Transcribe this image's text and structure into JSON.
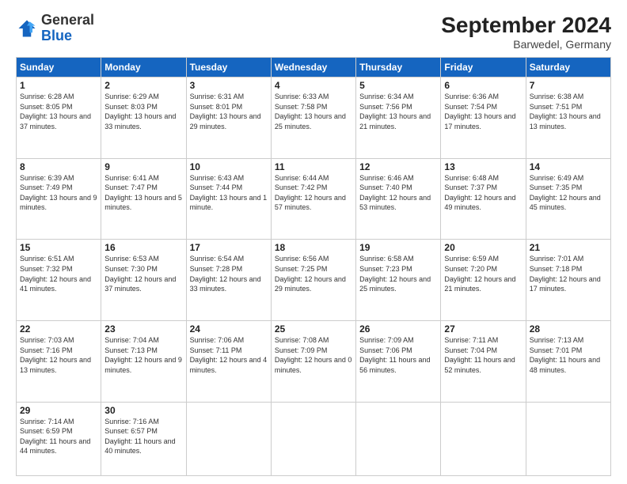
{
  "logo": {
    "general": "General",
    "blue": "Blue"
  },
  "title": "September 2024",
  "location": "Barwedel, Germany",
  "days_header": [
    "Sunday",
    "Monday",
    "Tuesday",
    "Wednesday",
    "Thursday",
    "Friday",
    "Saturday"
  ],
  "weeks": [
    [
      {
        "day": "1",
        "sunrise": "Sunrise: 6:28 AM",
        "sunset": "Sunset: 8:05 PM",
        "daylight": "Daylight: 13 hours and 37 minutes."
      },
      {
        "day": "2",
        "sunrise": "Sunrise: 6:29 AM",
        "sunset": "Sunset: 8:03 PM",
        "daylight": "Daylight: 13 hours and 33 minutes."
      },
      {
        "day": "3",
        "sunrise": "Sunrise: 6:31 AM",
        "sunset": "Sunset: 8:01 PM",
        "daylight": "Daylight: 13 hours and 29 minutes."
      },
      {
        "day": "4",
        "sunrise": "Sunrise: 6:33 AM",
        "sunset": "Sunset: 7:58 PM",
        "daylight": "Daylight: 13 hours and 25 minutes."
      },
      {
        "day": "5",
        "sunrise": "Sunrise: 6:34 AM",
        "sunset": "Sunset: 7:56 PM",
        "daylight": "Daylight: 13 hours and 21 minutes."
      },
      {
        "day": "6",
        "sunrise": "Sunrise: 6:36 AM",
        "sunset": "Sunset: 7:54 PM",
        "daylight": "Daylight: 13 hours and 17 minutes."
      },
      {
        "day": "7",
        "sunrise": "Sunrise: 6:38 AM",
        "sunset": "Sunset: 7:51 PM",
        "daylight": "Daylight: 13 hours and 13 minutes."
      }
    ],
    [
      {
        "day": "8",
        "sunrise": "Sunrise: 6:39 AM",
        "sunset": "Sunset: 7:49 PM",
        "daylight": "Daylight: 13 hours and 9 minutes."
      },
      {
        "day": "9",
        "sunrise": "Sunrise: 6:41 AM",
        "sunset": "Sunset: 7:47 PM",
        "daylight": "Daylight: 13 hours and 5 minutes."
      },
      {
        "day": "10",
        "sunrise": "Sunrise: 6:43 AM",
        "sunset": "Sunset: 7:44 PM",
        "daylight": "Daylight: 13 hours and 1 minute."
      },
      {
        "day": "11",
        "sunrise": "Sunrise: 6:44 AM",
        "sunset": "Sunset: 7:42 PM",
        "daylight": "Daylight: 12 hours and 57 minutes."
      },
      {
        "day": "12",
        "sunrise": "Sunrise: 6:46 AM",
        "sunset": "Sunset: 7:40 PM",
        "daylight": "Daylight: 12 hours and 53 minutes."
      },
      {
        "day": "13",
        "sunrise": "Sunrise: 6:48 AM",
        "sunset": "Sunset: 7:37 PM",
        "daylight": "Daylight: 12 hours and 49 minutes."
      },
      {
        "day": "14",
        "sunrise": "Sunrise: 6:49 AM",
        "sunset": "Sunset: 7:35 PM",
        "daylight": "Daylight: 12 hours and 45 minutes."
      }
    ],
    [
      {
        "day": "15",
        "sunrise": "Sunrise: 6:51 AM",
        "sunset": "Sunset: 7:32 PM",
        "daylight": "Daylight: 12 hours and 41 minutes."
      },
      {
        "day": "16",
        "sunrise": "Sunrise: 6:53 AM",
        "sunset": "Sunset: 7:30 PM",
        "daylight": "Daylight: 12 hours and 37 minutes."
      },
      {
        "day": "17",
        "sunrise": "Sunrise: 6:54 AM",
        "sunset": "Sunset: 7:28 PM",
        "daylight": "Daylight: 12 hours and 33 minutes."
      },
      {
        "day": "18",
        "sunrise": "Sunrise: 6:56 AM",
        "sunset": "Sunset: 7:25 PM",
        "daylight": "Daylight: 12 hours and 29 minutes."
      },
      {
        "day": "19",
        "sunrise": "Sunrise: 6:58 AM",
        "sunset": "Sunset: 7:23 PM",
        "daylight": "Daylight: 12 hours and 25 minutes."
      },
      {
        "day": "20",
        "sunrise": "Sunrise: 6:59 AM",
        "sunset": "Sunset: 7:20 PM",
        "daylight": "Daylight: 12 hours and 21 minutes."
      },
      {
        "day": "21",
        "sunrise": "Sunrise: 7:01 AM",
        "sunset": "Sunset: 7:18 PM",
        "daylight": "Daylight: 12 hours and 17 minutes."
      }
    ],
    [
      {
        "day": "22",
        "sunrise": "Sunrise: 7:03 AM",
        "sunset": "Sunset: 7:16 PM",
        "daylight": "Daylight: 12 hours and 13 minutes."
      },
      {
        "day": "23",
        "sunrise": "Sunrise: 7:04 AM",
        "sunset": "Sunset: 7:13 PM",
        "daylight": "Daylight: 12 hours and 9 minutes."
      },
      {
        "day": "24",
        "sunrise": "Sunrise: 7:06 AM",
        "sunset": "Sunset: 7:11 PM",
        "daylight": "Daylight: 12 hours and 4 minutes."
      },
      {
        "day": "25",
        "sunrise": "Sunrise: 7:08 AM",
        "sunset": "Sunset: 7:09 PM",
        "daylight": "Daylight: 12 hours and 0 minutes."
      },
      {
        "day": "26",
        "sunrise": "Sunrise: 7:09 AM",
        "sunset": "Sunset: 7:06 PM",
        "daylight": "Daylight: 11 hours and 56 minutes."
      },
      {
        "day": "27",
        "sunrise": "Sunrise: 7:11 AM",
        "sunset": "Sunset: 7:04 PM",
        "daylight": "Daylight: 11 hours and 52 minutes."
      },
      {
        "day": "28",
        "sunrise": "Sunrise: 7:13 AM",
        "sunset": "Sunset: 7:01 PM",
        "daylight": "Daylight: 11 hours and 48 minutes."
      }
    ],
    [
      {
        "day": "29",
        "sunrise": "Sunrise: 7:14 AM",
        "sunset": "Sunset: 6:59 PM",
        "daylight": "Daylight: 11 hours and 44 minutes."
      },
      {
        "day": "30",
        "sunrise": "Sunrise: 7:16 AM",
        "sunset": "Sunset: 6:57 PM",
        "daylight": "Daylight: 11 hours and 40 minutes."
      },
      null,
      null,
      null,
      null,
      null
    ]
  ]
}
